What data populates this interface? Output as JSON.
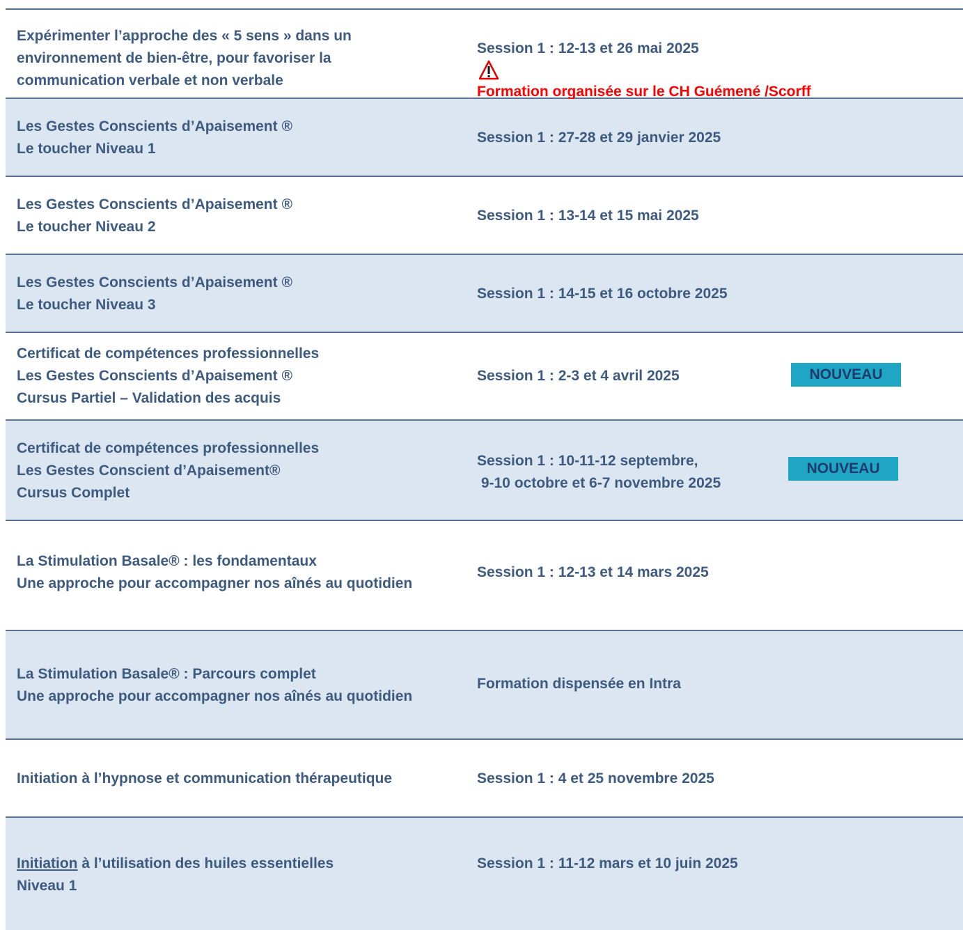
{
  "colors": {
    "text": "#3d5a80",
    "row_alt_background": "#dce6f1",
    "border": "#5a7394",
    "warning": "#ff0000",
    "badge_background": "#1ea6c4",
    "badge_text": "#1f3a6b"
  },
  "rows": [
    {
      "title": [
        "Expérimenter l’approche des « 5 sens » dans un",
        "environnement de bien-être, pour favoriser la",
        "communication verbale et non verbale"
      ],
      "session": [
        "Session 1 : 12-13 et 26 mai 2025"
      ],
      "warning_icon": "warning-triangle-icon",
      "warning_text": "Formation organisée  sur le CH Guémené /Scorff"
    },
    {
      "title": [
        "Les Gestes Conscients d’Apaisement ®",
        "Le toucher Niveau 1"
      ],
      "session": [
        "Session 1 : 27-28 et 29 janvier 2025"
      ]
    },
    {
      "title": [
        "Les Gestes Conscients d’Apaisement ®",
        "Le toucher Niveau 2"
      ],
      "session": [
        "Session 1 : 13-14 et 15 mai 2025"
      ]
    },
    {
      "title": [
        "Les Gestes Conscients d’Apaisement ®",
        "Le toucher Niveau 3"
      ],
      "session": [
        "Session 1 : 14-15 et 16 octobre 2025"
      ]
    },
    {
      "title": [
        "Certificat de compétences professionnelles",
        "Les Gestes Conscients d’Apaisement ®",
        "Cursus Partiel – Validation des acquis"
      ],
      "session": [
        "Session 1 : 2-3 et 4 avril 2025"
      ],
      "badge": "NOUVEAU"
    },
    {
      "title": [
        "Certificat de compétences professionnelles",
        "Les Gestes Conscient d’Apaisement®",
        "Cursus Complet"
      ],
      "session": [
        "Session 1 : 10-11-12 septembre,",
        " 9-10 octobre et 6-7 novembre 2025"
      ],
      "badge": "NOUVEAU"
    },
    {
      "title": [
        "La Stimulation Basale® : les fondamentaux",
        "Une approche pour accompagner nos aînés au quotidien"
      ],
      "session": [
        "Session 1 : 12-13 et 14 mars 2025"
      ]
    },
    {
      "title": [
        "La Stimulation Basale® : Parcours complet",
        "Une approche pour accompagner nos aînés au quotidien"
      ],
      "session": [
        "Formation dispensée en Intra"
      ]
    },
    {
      "title": [
        "Initiation à l’hypnose et communication thérapeutique"
      ],
      "session": [
        "Session 1 : 4 et 25 novembre 2025"
      ]
    },
    {
      "title_underlined": "Initiation",
      "title_rest": " à l’utilisation des huiles essentielles",
      "title_line2": "Niveau 1",
      "session": [
        "Session 1 : 11-12 mars et 10 juin 2025"
      ]
    }
  ]
}
